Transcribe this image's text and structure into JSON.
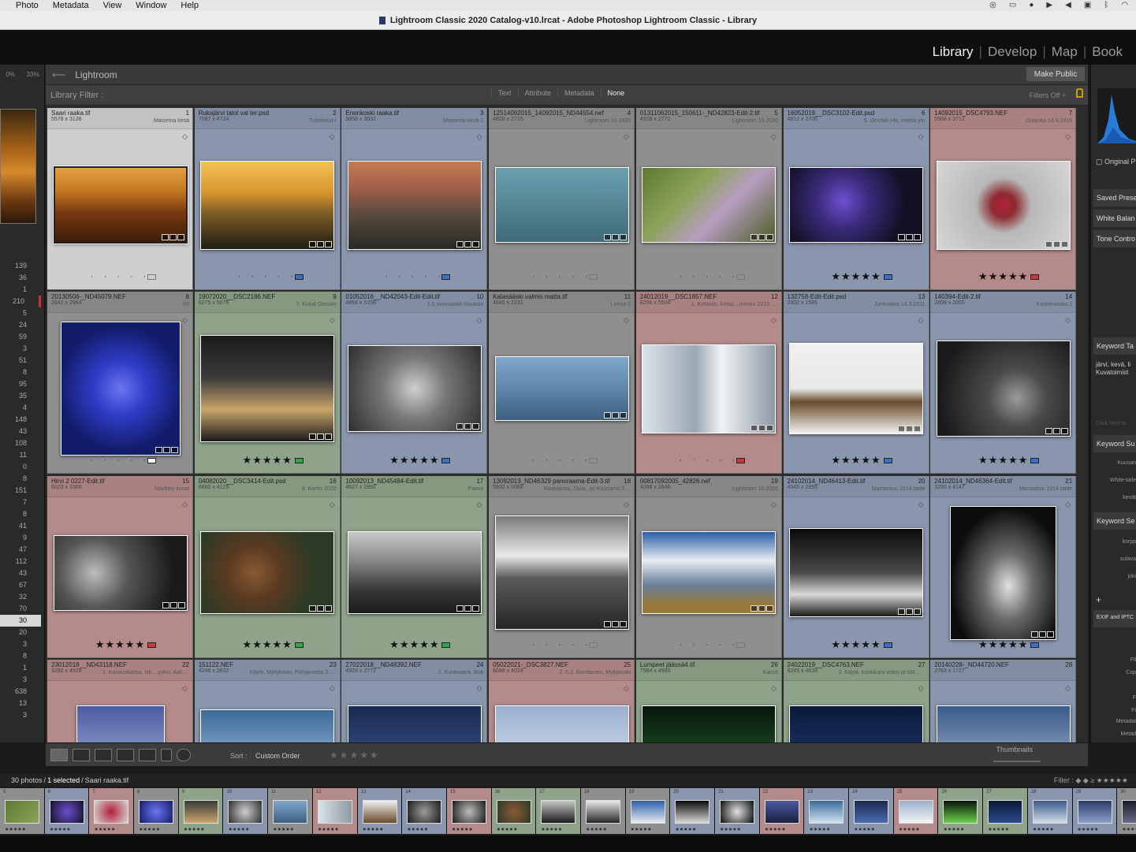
{
  "menubar": {
    "items": [
      "Photo",
      "Metadata",
      "View",
      "Window",
      "Help"
    ]
  },
  "window": {
    "title": "Lightroom Classic 2020 Catalog-v10.lrcat - Adobe Photoshop Lightroom Classic - Library"
  },
  "modules": {
    "library": "Library",
    "develop": "Develop",
    "map": "Map",
    "book": "Book"
  },
  "left": {
    "zoom": [
      "0%",
      "33%"
    ],
    "counts": [
      "139",
      "36",
      "1",
      "210",
      "5",
      "24",
      "59",
      "3",
      "51",
      "8",
      "95",
      "35",
      "4",
      "148",
      "43",
      "108",
      "11",
      "0",
      "8",
      "151",
      "7",
      "8",
      "41",
      "9",
      "47",
      "112",
      "43",
      "67",
      "32",
      "70",
      "30",
      "20",
      "3",
      "8",
      "1",
      "3",
      "638",
      "13",
      "3"
    ],
    "selected_count": "30"
  },
  "crumb": {
    "title": "Lightroom",
    "make_public": "Make Public"
  },
  "filter": {
    "label": "Library Filter :",
    "tabs": [
      "Text",
      "Attribute",
      "Metadata",
      "None"
    ],
    "active": "None",
    "filters_off": "Filters Off ÷"
  },
  "grid": {
    "cells": [
      {
        "n": "1",
        "file": "Saari raaka.tif",
        "dim": "5578 x 3138",
        "cap": "Maisema kesä",
        "rating": "· · · · ·",
        "label": "none",
        "bg": "#cfcfcf",
        "img": "linear-gradient(180deg,#e3a040 0%,#c67a22 30%,#7a3a10 60%,#3a1c08 100%)",
        "sel": true
      },
      {
        "n": "2",
        "file": "Rukajärvi talot val ter.psd",
        "dim": "7087 x 4724",
        "cap": "Tulostetut-I",
        "rating": "· · · · ·",
        "label": "#3b6fc8",
        "bg": "#8996ad",
        "img": "linear-gradient(180deg,#f2c255 0%,#d9962e 35%,#7a5b26 60%,#1e1c14 100%)"
      },
      {
        "n": "3",
        "file": "Enonkoski raaka.tif",
        "dim": "5898 x 3932",
        "cap": "Maisema kesä-2",
        "rating": "· · · · ·",
        "label": "#3b6fc8",
        "bg": "#8996ad",
        "img": "linear-gradient(180deg,#c77a4f 0%,#a1604a 30%,#5a4a3e 60%,#252a26 100%)"
      },
      {
        "n": "4",
        "file": "12514092015_14092015_ND44554.nef",
        "dim": "4828 x 2715",
        "cap": "Lightroom 10.2020",
        "rating": "· · · · ·",
        "label": "none",
        "bg": "#8f8f8f",
        "img": "linear-gradient(180deg,#6b9fae 0%,#5a8c9c 40%,#3f6a78 100%)"
      },
      {
        "n": "5",
        "file": "01311062015_150611-_ND42823-Edit-2.tif",
        "dim": "4928 x 2772",
        "cap": "Lightroom 10.2020",
        "rating": "· · · · ·",
        "label": "none",
        "bg": "#8f8f8f",
        "img": "linear-gradient(135deg,#5d7a2e 0%,#8ca35a 35%,#b69dc0 60%,#4a5e24 100%)"
      },
      {
        "n": "6",
        "file": "16052019__DSC3102-Edit.psd",
        "dim": "4812 x 2706",
        "cap": "5. Orvokki Hki, metsä ym",
        "rating": "★★★★★",
        "label": "#3b6fc8",
        "bg": "#8996ad",
        "img": "radial-gradient(circle at 40% 45%,#6e4fd1 0%,#3a2a7a 30%,#121024 70%)"
      },
      {
        "n": "7",
        "file": "14092015_DSC4793.NEF",
        "dim": "5568 x 3712",
        "cap": "Oulanka 14.9.2015",
        "rating": "★★★★★",
        "label": "#c53b3b",
        "bg": "#b48a8a",
        "img": "radial-gradient(circle at 50% 50%,#b3203a 0%,#8d2a30 15%,#b8b8b8 35%,#d6d6d6 100%)"
      },
      {
        "n": "8",
        "file": "20130506-_ND45079.NEF",
        "dim": "2642 x 2964",
        "cap": "06",
        "rating": "· · · · ·",
        "label": "#ffffff",
        "bg": "#8f8f8f",
        "img": "radial-gradient(circle at 50% 50%,#6c75f0 0%,#2f3dc8 30%,#121c6a 70%)"
      },
      {
        "n": "9",
        "file": "19072020__DSC2186.NEF",
        "dim": "6275 x 5079",
        "cap": "7. Kukat Oitmäki",
        "rating": "★★★★★",
        "label": "#2fa84a",
        "bg": "#8ea38a",
        "img": "linear-gradient(180deg,#1a1a1a 0%,#3a3a3a 40%,#c9a46a 70%,#1a1a1a 100%)"
      },
      {
        "n": "10",
        "file": "01052016__ND42043-Edit-Edit.tif",
        "dim": "4868 x 3159",
        "cap": "1.5 sinivuokko Nuuksio",
        "rating": "★★★★★",
        "label": "#3b6fc8",
        "bg": "#8996ad",
        "img": "radial-gradient(circle at 50% 50%,#cfcfcf 0%,#777 40%,#2e2e2e 100%)"
      },
      {
        "n": "11",
        "file": "Kalasääski valmis matta.tif",
        "dim": "4645 x 2231",
        "cap": "Linnut-2",
        "rating": "· · · · ·",
        "label": "none",
        "bg": "#8f8f8f",
        "img": "linear-gradient(180deg,#7fa8cc 0%,#5f86ad 50%,#3e5f80 100%)"
      },
      {
        "n": "12",
        "file": "24012019__DSC1857.NEF",
        "dim": "8256 x 5504",
        "cap": "1. Kotikolo, luhtia....mmiku 2019 Bob",
        "rating": "· · · · ·",
        "label": "#c53b3b",
        "bg": "#b48a8a",
        "img": "linear-gradient(90deg,#dbe3ea 0%,#9aa7b2 40%,#f0f3f5 60%,#8c99a4 100%)"
      },
      {
        "n": "13",
        "file": "132758-Edit-Edit.psd",
        "dim": "2302 x 1585",
        "cap": "Juhtivaara 14.3.2011",
        "rating": "★★★★★",
        "label": "#3b6fc8",
        "bg": "#8996ad",
        "img": "linear-gradient(180deg,#f0f0f0 0%,#e8e8e8 50%,#6a4a2a 65%,#f2f2f2 100%)"
      },
      {
        "n": "14",
        "file": "140394-Edit-2.tif",
        "dim": "2808 x 2005",
        "cap": "Koskenlasku 1",
        "rating": "★★★★★",
        "label": "#3b6fc8",
        "bg": "#8996ad",
        "img": "radial-gradient(circle at 60% 60%,#9a9a9a 0%,#4a4a4a 30%,#1a1a1a 80%)"
      },
      {
        "n": "15",
        "file": "Hirvi 2 0227-Edit.tif",
        "dim": "6023 x 3388",
        "cap": "Näyttely kuvat",
        "rating": "★★★★★",
        "label": "#c53b3b",
        "bg": "#b48a8a",
        "img": "radial-gradient(circle at 30% 50%,#bdbdbd 0%,#555 35%,#1a1a1a 80%)"
      },
      {
        "n": "16",
        "file": "04082020__DSC3414-Edit.psd",
        "dim": "6660 x 4129",
        "cap": "8. Karhu 2020",
        "rating": "★★★★★",
        "label": "#2fa84a",
        "bg": "#8ea38a",
        "img": "radial-gradient(circle at 40% 50%,#8a5a34 0%,#5a3a20 30%,#2a3a26 70%)"
      },
      {
        "n": "17",
        "file": "10092013_ND45484-Edit.tif",
        "dim": "4627 x 2892",
        "cap": "Paavo",
        "rating": "★★★★★",
        "label": "#2fa84a",
        "bg": "#8ea38a",
        "img": "linear-gradient(180deg,#c8c8c8 0%,#888 35%,#3a3a3a 70%,#1a1a1a 100%)"
      },
      {
        "n": "18",
        "file": "13092013_ND46329 panoraama-Edit-3.tif",
        "dim": "5932 x 5088",
        "cap": "Kaakakuru, Oula...ljo Kuusamo 2013",
        "rating": "· · · · ·",
        "label": "none",
        "bg": "#8f8f8f",
        "img": "linear-gradient(180deg,#7a7a7a 0%,#eaeaea 35%,#5a5a5a 55%,#262626 100%)"
      },
      {
        "n": "19",
        "file": "00817092005_42826.nef",
        "dim": "4288 x 2848",
        "cap": "Lightroom 10.2020",
        "rating": "· · · · ·",
        "label": "none",
        "bg": "#8f8f8f",
        "img": "linear-gradient(180deg,#2a5ea8 0%,#e8ecf2 35%,#6a7f9a 65%,#9a7a3a 90%)"
      },
      {
        "n": "20",
        "file": "24102014_ND46413-Edit.tif",
        "dim": "4345 x 2895",
        "cap": "Marraskuu 2014 taide",
        "rating": "★★★★★",
        "label": "#3b6fc8",
        "bg": "#8996ad",
        "img": "linear-gradient(180deg,#0a0a0a 0%,#4a4a4a 50%,#d8d8d8 75%,#1a1a1a 100%)"
      },
      {
        "n": "21",
        "file": "24102014_ND46364-Edit.tif",
        "dim": "3280 x 4147",
        "cap": "Marraskuu 2014 taide",
        "rating": "★★★★★",
        "label": "#3b6fc8",
        "bg": "#8996ad",
        "img": "radial-gradient(ellipse at 55% 60%,#e2e2e2 0%,#6a6a6a 30%,#0c0c0c 70%)"
      },
      {
        "n": "22",
        "file": "23012018__ND43118.NEF",
        "dim": "3280 x 4928",
        "cap": "1. Kuvauskassa, Iitk....yöksi, Aalloiklokstes",
        "rating": "",
        "label": "none",
        "bg": "#b48a8a",
        "img": "linear-gradient(180deg,#4a5aa0 0%,#8a9ac8 50%,#1a2040 100%)"
      },
      {
        "n": "23",
        "file": "151122.NEF",
        "dim": "4248 x 2832",
        "cap": "Käylä, Myllykoski, Pohjanselta 2012",
        "rating": "",
        "label": "none",
        "bg": "#8996ad",
        "img": "linear-gradient(180deg,#3a6a9a 0%,#cfe2f0 100%)"
      },
      {
        "n": "24",
        "file": "27022018__ND48392.NEF",
        "dim": "4928 x 2772",
        "cap": "2. Kuntivaara, Bob",
        "rating": "",
        "label": "none",
        "bg": "#8996ad",
        "img": "linear-gradient(180deg,#1a2a50 0%,#4a6ab0 100%)"
      },
      {
        "n": "25",
        "file": "05022021-_DSC3827.NEF",
        "dim": "6048 x 4024",
        "cap": "2. 5.2. Konttainen, Myllykoski",
        "rating": "",
        "label": "none",
        "bg": "#b48a8a",
        "img": "linear-gradient(180deg,#9ab0d0 0%,#f4f4f4 100%)"
      },
      {
        "n": "26",
        "file": "Lumpeet jäässä4.tif",
        "dim": "7564 x 4960",
        "cap": "Kasvit",
        "rating": "",
        "label": "none",
        "bg": "#8ea38a",
        "img": "linear-gradient(180deg,#08140a 0%,#1a5a2a 60%,#6ad04a 100%)"
      },
      {
        "n": "27",
        "file": "24022019__DSC4763.NEF",
        "dim": "8245 x 4638",
        "cap": "2. Käylä, koskikara video ja still, Bob",
        "rating": "",
        "label": "none",
        "bg": "#8ea38a",
        "img": "linear-gradient(180deg,#0a1a3a 0%,#2a4a8a 100%)"
      },
      {
        "n": "28",
        "file": "20140228-_ND44720.NEF",
        "dim": "2763 x 1727",
        "cap": "",
        "rating": "",
        "label": "none",
        "bg": "#8996ad",
        "img": "linear-gradient(180deg,#3a5a8a 0%,#d0dde8 100%)"
      }
    ]
  },
  "right": {
    "original": "Original P",
    "saved": "Saved Prese",
    "white": "White Balan",
    "tone": "Tone Contro",
    "kw_tags": "Keyword Ta",
    "kw_text1": "järvi, kevä, li",
    "kw_text2": "Kuvatoimist",
    "click_here": "Click here to",
    "kw_sugg": "Keyword Su",
    "sugg": [
      "Kuusan",
      "White-taile",
      "kevät"
    ],
    "kw_set": "Keyword Se",
    "sets": [
      "korpp",
      "sulava",
      "joki"
    ],
    "exif": "EXIF and IPTC",
    "fields": [
      "Fil",
      "Cop",
      "F",
      "Fi",
      "Metadat",
      "Metad"
    ]
  },
  "toolbar": {
    "sort_label": "Sort :",
    "sort_value": "Custom Order",
    "stars": "★★★★★",
    "thumbs": "Thumbnails"
  },
  "filmstrip_hdr": {
    "count": "30 photos",
    "selected": "1 selected",
    "file": "Saari raaka.tif",
    "filter": "Filter :"
  },
  "filmstrip": [
    {
      "n": "5",
      "g": "linear-gradient(135deg,#5d7a2e,#8ca35a)",
      "bg": "#8f8f8f"
    },
    {
      "n": "6",
      "g": "radial-gradient(circle,#6e4fd1,#121024)",
      "bg": "#8996ad"
    },
    {
      "n": "7",
      "g": "radial-gradient(circle,#b3203a,#d6d6d6)",
      "bg": "#b48a8a"
    },
    {
      "n": "8",
      "g": "radial-gradient(circle,#6c75f0,#121c6a)",
      "bg": "#8f8f8f"
    },
    {
      "n": "9",
      "g": "linear-gradient(180deg,#3a3a3a,#c9a46a)",
      "bg": "#8ea38a"
    },
    {
      "n": "10",
      "g": "radial-gradient(circle,#cfcfcf,#2e2e2e)",
      "bg": "#8996ad"
    },
    {
      "n": "11",
      "g": "linear-gradient(180deg,#7fa8cc,#3e5f80)",
      "bg": "#8f8f8f"
    },
    {
      "n": "12",
      "g": "linear-gradient(90deg,#dbe3ea,#8c99a4)",
      "bg": "#b48a8a"
    },
    {
      "n": "13",
      "g": "linear-gradient(180deg,#f0f0f0,#6a4a2a)",
      "bg": "#8996ad"
    },
    {
      "n": "14",
      "g": "radial-gradient(circle,#9a9a9a,#1a1a1a)",
      "bg": "#8996ad"
    },
    {
      "n": "15",
      "g": "radial-gradient(circle,#bdbdbd,#1a1a1a)",
      "bg": "#b48a8a"
    },
    {
      "n": "16",
      "g": "radial-gradient(circle,#8a5a34,#2a3a26)",
      "bg": "#8ea38a"
    },
    {
      "n": "17",
      "g": "linear-gradient(180deg,#c8c8c8,#1a1a1a)",
      "bg": "#8ea38a"
    },
    {
      "n": "18",
      "g": "linear-gradient(180deg,#eaeaea,#262626)",
      "bg": "#8f8f8f"
    },
    {
      "n": "19",
      "g": "linear-gradient(180deg,#2a5ea8,#e8ecf2)",
      "bg": "#8f8f8f"
    },
    {
      "n": "20",
      "g": "linear-gradient(180deg,#0a0a0a,#d8d8d8)",
      "bg": "#8996ad"
    },
    {
      "n": "21",
      "g": "radial-gradient(circle,#e2e2e2,#0c0c0c)",
      "bg": "#8996ad"
    },
    {
      "n": "22",
      "g": "linear-gradient(180deg,#4a5aa0,#1a2040)",
      "bg": "#b48a8a"
    },
    {
      "n": "23",
      "g": "linear-gradient(180deg,#3a6a9a,#cfe2f0)",
      "bg": "#8996ad"
    },
    {
      "n": "24",
      "g": "linear-gradient(180deg,#1a2a50,#4a6ab0)",
      "bg": "#8996ad"
    },
    {
      "n": "25",
      "g": "linear-gradient(180deg,#9ab0d0,#f4f4f4)",
      "bg": "#b48a8a"
    },
    {
      "n": "26",
      "g": "linear-gradient(180deg,#08140a,#6ad04a)",
      "bg": "#8ea38a"
    },
    {
      "n": "27",
      "g": "linear-gradient(180deg,#0a1a3a,#2a4a8a)",
      "bg": "#8ea38a"
    },
    {
      "n": "28",
      "g": "linear-gradient(180deg,#3a5a8a,#d0dde8)",
      "bg": "#8996ad"
    },
    {
      "n": "29",
      "g": "linear-gradient(180deg,#2a3a6a,#8aa0c8)",
      "bg": "#8996ad"
    },
    {
      "n": "30",
      "g": "linear-gradient(180deg,#1a1a2a,#6a6a8a)",
      "bg": "#8f8f8f"
    }
  ]
}
